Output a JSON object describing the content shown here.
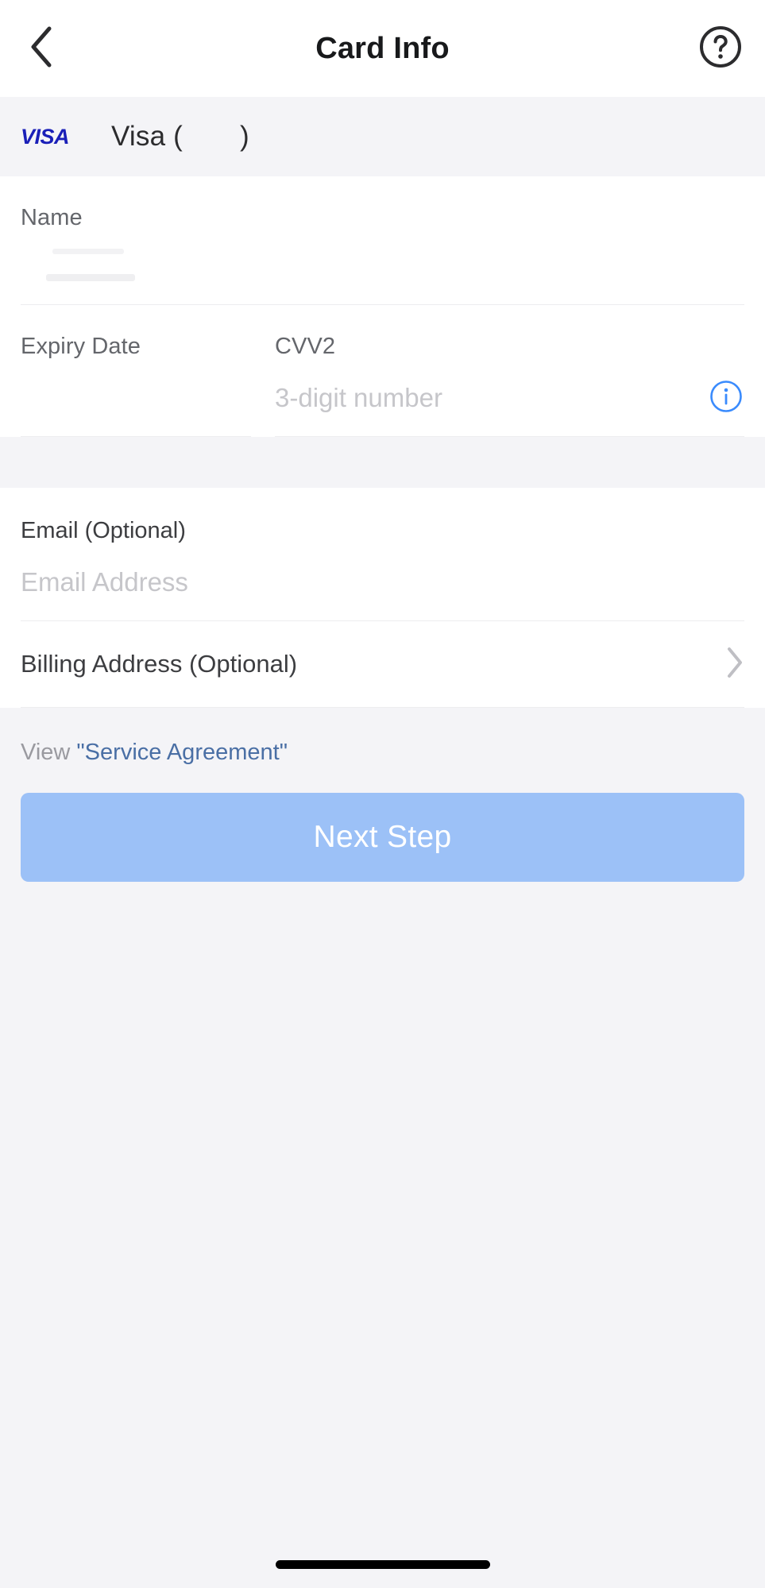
{
  "header": {
    "title": "Card Info",
    "back_icon": "chevron-left-icon",
    "help_icon": "question-circle-icon"
  },
  "card": {
    "brand_logo": "visa-logo",
    "brand_logo_text": "VISA",
    "label_prefix": "Visa (",
    "masked_number": "",
    "label_suffix": ")"
  },
  "form": {
    "name": {
      "label": "Name",
      "value": "",
      "placeholder": ""
    },
    "expiry": {
      "label": "Expiry Date",
      "value": "",
      "placeholder": ""
    },
    "cvv": {
      "label": "CVV2",
      "value": "",
      "placeholder": "3-digit number",
      "info_icon": "info-circle-icon"
    }
  },
  "optional": {
    "email": {
      "label": "Email (Optional)",
      "value": "",
      "placeholder": "Email Address"
    },
    "billing_address": {
      "label": "Billing Address (Optional)",
      "chevron_icon": "chevron-right-icon"
    }
  },
  "footer": {
    "agreement_prefix": "View ",
    "agreement_link": "\"Service Agreement\"",
    "next_button": "Next Step"
  },
  "colors": {
    "accent_blue": "#3A8BFD",
    "button_blue": "#9CC1F7",
    "link_blue": "#4A6FA5",
    "visa_blue": "#1A1FB8",
    "page_bg": "#F4F4F7"
  }
}
